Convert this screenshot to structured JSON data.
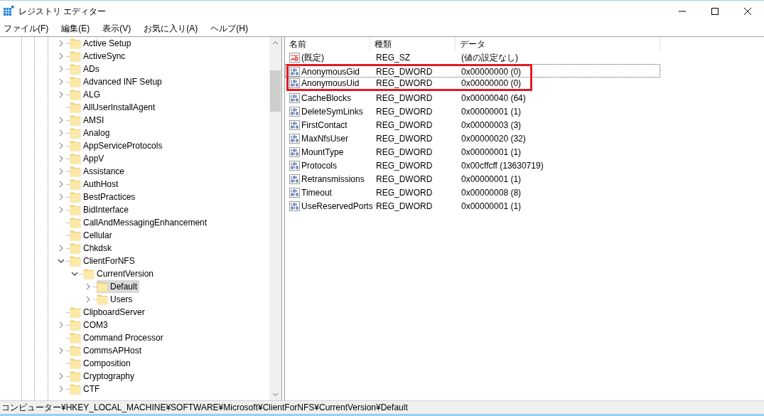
{
  "window": {
    "title": "レジストリ エディター"
  },
  "menu": [
    "ファイル(F)",
    "編集(E)",
    "表示(V)",
    "お気に入り(A)",
    "ヘルプ(H)"
  ],
  "tree": [
    {
      "label": "Active Setup",
      "expandable": true,
      "expanded": false,
      "selected": false
    },
    {
      "label": "ActiveSync",
      "expandable": true,
      "expanded": false,
      "selected": false
    },
    {
      "label": "ADs",
      "expandable": true,
      "expanded": false,
      "selected": false
    },
    {
      "label": "Advanced INF Setup",
      "expandable": true,
      "expanded": false,
      "selected": false
    },
    {
      "label": "ALG",
      "expandable": true,
      "expanded": false,
      "selected": false
    },
    {
      "label": "AllUserInstallAgent",
      "expandable": false,
      "selected": false
    },
    {
      "label": "AMSI",
      "expandable": true,
      "expanded": false,
      "selected": false
    },
    {
      "label": "Analog",
      "expandable": true,
      "expanded": false,
      "selected": false
    },
    {
      "label": "AppServiceProtocols",
      "expandable": true,
      "expanded": false,
      "selected": false
    },
    {
      "label": "AppV",
      "expandable": true,
      "expanded": false,
      "selected": false
    },
    {
      "label": "Assistance",
      "expandable": true,
      "expanded": false,
      "selected": false
    },
    {
      "label": "AuthHost",
      "expandable": true,
      "expanded": false,
      "selected": false
    },
    {
      "label": "BestPractices",
      "expandable": true,
      "expanded": false,
      "selected": false
    },
    {
      "label": "BidInterface",
      "expandable": true,
      "expanded": false,
      "selected": false
    },
    {
      "label": "CallAndMessagingEnhancement",
      "expandable": false,
      "selected": false
    },
    {
      "label": "Cellular",
      "expandable": false,
      "selected": false
    },
    {
      "label": "Chkdsk",
      "expandable": true,
      "expanded": false,
      "selected": false
    },
    {
      "label": "ClientForNFS",
      "expandable": true,
      "expanded": true,
      "selected": false,
      "children": [
        {
          "label": "CurrentVersion",
          "expandable": true,
          "expanded": true,
          "selected": false,
          "children": [
            {
              "label": "Default",
              "expandable": true,
              "expanded": false,
              "selected": true
            },
            {
              "label": "Users",
              "expandable": true,
              "expanded": false,
              "selected": false
            }
          ]
        }
      ]
    },
    {
      "label": "ClipboardServer",
      "expandable": false,
      "selected": false
    },
    {
      "label": "COM3",
      "expandable": true,
      "expanded": false,
      "selected": false
    },
    {
      "label": "Command Processor",
      "expandable": false,
      "selected": false
    },
    {
      "label": "CommsAPHost",
      "expandable": true,
      "expanded": false,
      "selected": false
    },
    {
      "label": "Composition",
      "expandable": false,
      "selected": false
    },
    {
      "label": "Cryptography",
      "expandable": true,
      "expanded": false,
      "selected": false
    },
    {
      "label": "CTF",
      "expandable": true,
      "expanded": false,
      "selected": false
    }
  ],
  "values": {
    "columns": [
      "名前",
      "種類",
      "データ"
    ],
    "rows": [
      {
        "kind": "string",
        "name": "(既定)",
        "type": "REG_SZ",
        "data": "(値の設定なし)",
        "focused": false,
        "highlighted": false
      },
      {
        "kind": "dword",
        "name": "AnonymousGid",
        "type": "REG_DWORD",
        "data": "0x00000000 (0)",
        "focused": true,
        "highlighted": true
      },
      {
        "kind": "dword",
        "name": "AnonymousUid",
        "type": "REG_DWORD",
        "data": "0x00000000 (0)",
        "focused": false,
        "highlighted": true
      },
      {
        "kind": "dword",
        "name": "CacheBlocks",
        "type": "REG_DWORD",
        "data": "0x00000040 (64)",
        "focused": false,
        "highlighted": false
      },
      {
        "kind": "dword",
        "name": "DeleteSymLinks",
        "type": "REG_DWORD",
        "data": "0x00000001 (1)",
        "focused": false,
        "highlighted": false
      },
      {
        "kind": "dword",
        "name": "FirstContact",
        "type": "REG_DWORD",
        "data": "0x00000003 (3)",
        "focused": false,
        "highlighted": false
      },
      {
        "kind": "dword",
        "name": "MaxNfsUser",
        "type": "REG_DWORD",
        "data": "0x00000020 (32)",
        "focused": false,
        "highlighted": false
      },
      {
        "kind": "dword",
        "name": "MountType",
        "type": "REG_DWORD",
        "data": "0x00000001 (1)",
        "focused": false,
        "highlighted": false
      },
      {
        "kind": "dword",
        "name": "Protocols",
        "type": "REG_DWORD",
        "data": "0x00cffcff (13630719)",
        "focused": false,
        "highlighted": false
      },
      {
        "kind": "dword",
        "name": "Retransmissions",
        "type": "REG_DWORD",
        "data": "0x00000001 (1)",
        "focused": false,
        "highlighted": false
      },
      {
        "kind": "dword",
        "name": "Timeout",
        "type": "REG_DWORD",
        "data": "0x00000008 (8)",
        "focused": false,
        "highlighted": false
      },
      {
        "kind": "dword",
        "name": "UseReservedPorts",
        "type": "REG_DWORD",
        "data": "0x00000001 (1)",
        "focused": false,
        "highlighted": false
      }
    ]
  },
  "status_bar": "コンピューター¥HKEY_LOCAL_MACHINE¥SOFTWARE¥Microsoft¥ClientForNFS¥CurrentVersion¥Default"
}
